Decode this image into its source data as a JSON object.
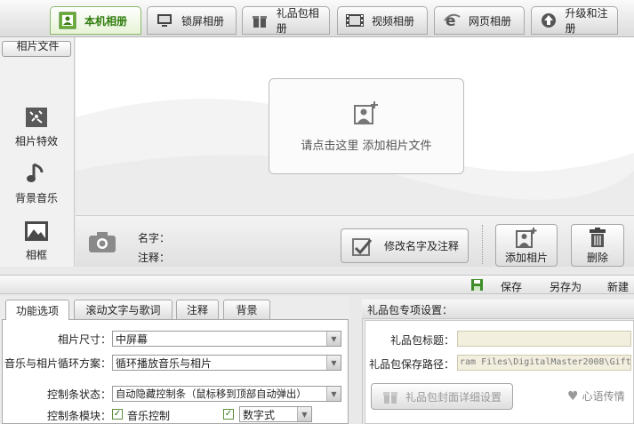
{
  "tabs": [
    {
      "label": "本机相册",
      "icon": "photo-frame-icon"
    },
    {
      "label": "锁屏相册",
      "icon": "monitor-icon"
    },
    {
      "label": "礼品包相册",
      "icon": "gift-icon"
    },
    {
      "label": "视频相册",
      "icon": "film-icon"
    },
    {
      "label": "网页相册",
      "icon": "ie-browser-icon"
    },
    {
      "label": "升级和注册",
      "icon": "upgrade-globe-icon"
    }
  ],
  "sidebar": {
    "items": [
      {
        "label": "相片文件",
        "icon": "camera-icon"
      },
      {
        "label": "相片特效",
        "icon": "effects-icon"
      },
      {
        "label": "背景音乐",
        "icon": "music-note-icon"
      },
      {
        "label": "相框",
        "icon": "frame-icon"
      }
    ]
  },
  "main": {
    "add_prompt": "请点击这里  添加相片文件"
  },
  "info": {
    "name_label": "名字：",
    "note_label": "注释：",
    "edit_button": "修改名字及注释",
    "add_photo_button": "添加相片",
    "delete_button": "删除"
  },
  "savebar": {
    "save": "保存",
    "save_as": "另存为",
    "new": "新建"
  },
  "bottom_tabs": [
    "功能选项",
    "滚动文字与歌词",
    "注释",
    "背景"
  ],
  "options": {
    "photo_size_label": "相片尺寸：",
    "photo_size_value": "中屏幕",
    "loop_label": "音乐与相片循环方案：",
    "loop_value": "循环播放音乐与相片",
    "control_state_label": "控制条状态：",
    "control_state_value": "自动隐藏控制条（鼠标移到顶部自动弹出）",
    "control_module_label": "控制条模块：",
    "music_control_label": "音乐控制",
    "digital_label": "数字式"
  },
  "gift": {
    "header": "礼品包专项设置：",
    "title_label": "礼品包标题：",
    "title_value": "",
    "path_label": "礼品包保存路径：",
    "path_value": "ram Files\\DigitalMaster2008\\Gift",
    "cover_button": "礼品包封面详细设置",
    "heart_text": "心语传情"
  }
}
